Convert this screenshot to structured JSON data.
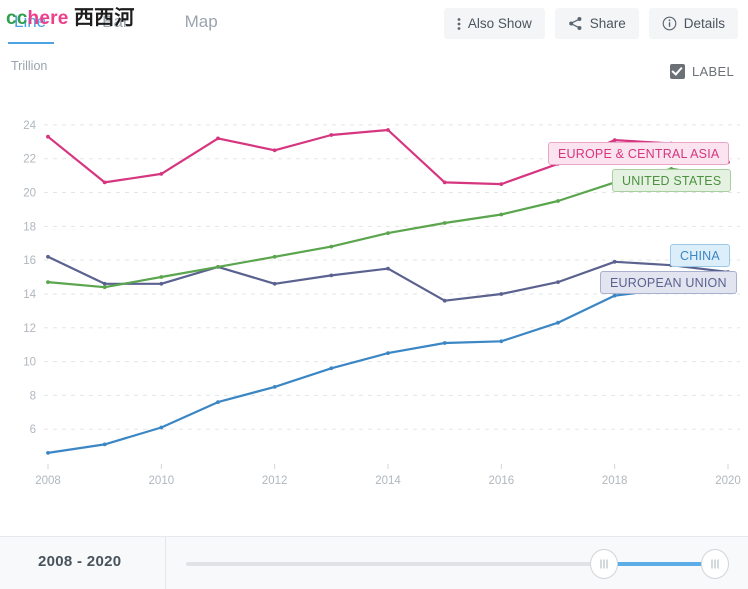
{
  "watermark": {
    "part1": "cc",
    "part2": "here",
    "part3": "西西河"
  },
  "header": {
    "tabs": [
      {
        "label": "Line",
        "active": true
      },
      {
        "label": "Bar",
        "active": false
      },
      {
        "label": "Map",
        "active": false
      }
    ],
    "buttons": [
      {
        "label": "Also Show",
        "icon": "vertical-dots-icon"
      },
      {
        "label": "Share",
        "icon": "share-icon"
      },
      {
        "label": "Details",
        "icon": "info-circle-icon"
      }
    ]
  },
  "toolbar": {
    "unit": "Trillion",
    "label_toggle": "LABEL",
    "label_checked": true
  },
  "footer": {
    "range": "2008 - 2020",
    "slider": {
      "left_handle": "range-start-handle",
      "right_handle": "range-end-handle"
    }
  },
  "chart_data": {
    "type": "line",
    "title": "",
    "xlabel": "",
    "ylabel": "Trillion",
    "xlim": [
      2008,
      2020
    ],
    "ylim": [
      4,
      25
    ],
    "xticks": [
      2008,
      2010,
      2012,
      2014,
      2016,
      2018,
      2020
    ],
    "yticks": [
      6,
      8,
      10,
      12,
      14,
      16,
      18,
      20,
      22,
      24
    ],
    "grid": true,
    "legend": "inline-badges",
    "x": [
      2008,
      2009,
      2010,
      2011,
      2012,
      2013,
      2014,
      2015,
      2016,
      2017,
      2018,
      2019,
      2020
    ],
    "series": [
      {
        "name": "EUROPE & CENTRAL ASIA",
        "color": "#d6357f",
        "values": [
          23.3,
          20.6,
          21.1,
          23.2,
          22.5,
          23.4,
          23.7,
          20.6,
          20.5,
          21.7,
          23.1,
          22.9,
          21.8
        ]
      },
      {
        "name": "UNITED STATES",
        "color": "#5aa54d",
        "values": [
          14.7,
          14.4,
          15.0,
          15.6,
          16.2,
          16.8,
          17.6,
          18.2,
          18.7,
          19.5,
          20.6,
          21.4,
          20.9
        ]
      },
      {
        "name": "EUROPEAN UNION",
        "color": "#5b628f",
        "values": [
          16.2,
          14.6,
          14.6,
          15.6,
          14.6,
          15.1,
          15.5,
          13.6,
          14.0,
          14.7,
          15.9,
          15.7,
          15.3
        ]
      },
      {
        "name": "CHINA",
        "color": "#3b86c4",
        "values": [
          4.6,
          5.1,
          6.1,
          7.6,
          8.5,
          9.6,
          10.5,
          11.1,
          11.2,
          12.3,
          13.9,
          14.3,
          14.7
        ]
      }
    ]
  }
}
